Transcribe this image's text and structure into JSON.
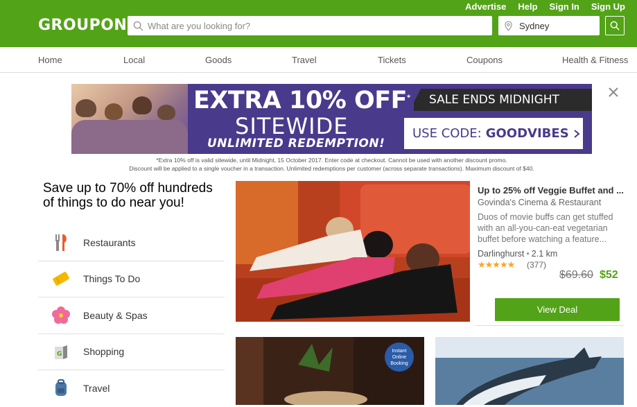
{
  "header": {
    "logo": "GROUPON",
    "toplinks": [
      "Advertise",
      "Help",
      "Sign In",
      "Sign Up"
    ],
    "search_placeholder": "What are you looking for?",
    "location": "Sydney"
  },
  "nav": [
    "Home",
    "Local",
    "Goods",
    "Travel",
    "Tickets",
    "Coupons",
    "Health & Fitness"
  ],
  "banner": {
    "headline": "EXTRA 10% OFF",
    "headline_mark": "*",
    "subheadline": "SITEWIDE",
    "tagline": "UNLIMITED REDEMPTION!",
    "sale_text": "SALE ENDS MIDNIGHT",
    "code_label": "USE CODE:",
    "code": "GOODVIBES",
    "fine_print_1": "*Extra 10% off is valid sitewide, until Midnight, 15 October 2017. Enter code at checkout. Cannot be used with another discount promo.",
    "fine_print_2": "Discount will be applied to a single voucher in a transaction. Unlimited redemptions per customer (across separate transactions). Maximum discount of $40."
  },
  "hero_text": "Save up to 70% off hundreds of things to do near you!",
  "categories": [
    "Restaurants",
    "Things To Do",
    "Beauty & Spas",
    "Shopping",
    "Travel"
  ],
  "deal": {
    "title": "Up to 25% off Veggie Buffet and ...",
    "merchant": "Govinda's Cinema & Restaurant",
    "description": "Duos of movie buffs can get stuffed with an all-you-can-eat vegetarian buffet before watching a feature...",
    "location": "Darlinghurst",
    "distance": "2.1 km",
    "rating_stars": "★★★★★",
    "rating_count": "(377)",
    "old_price": "$69.60",
    "new_price": "$52",
    "button": "View Deal"
  },
  "badge": "Instant Online Booking",
  "colors": {
    "brand": "#53a318",
    "banner": "#4a3a8c"
  }
}
